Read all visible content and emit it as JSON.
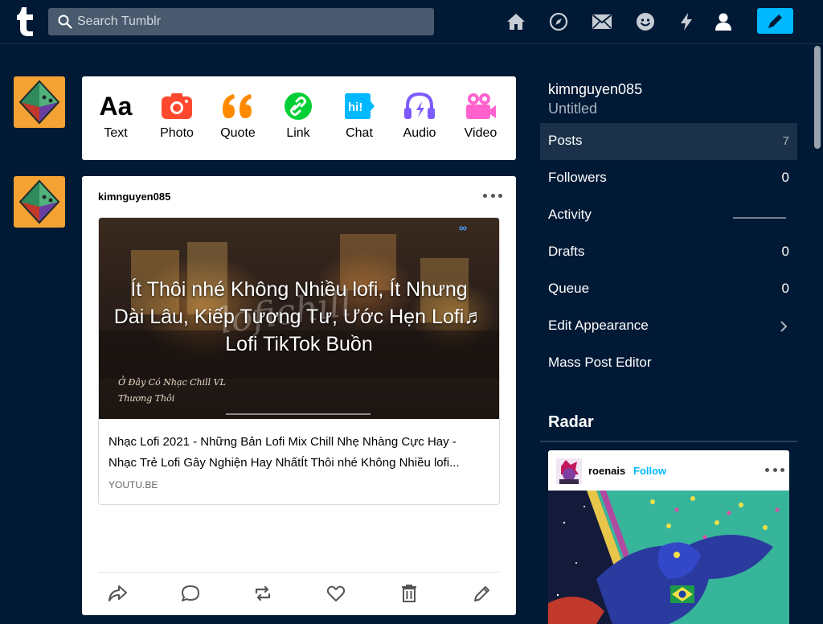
{
  "header": {
    "search_placeholder": "Search Tumblr",
    "nav_icons": [
      "home-icon",
      "explore-icon",
      "inbox-icon",
      "messaging-icon",
      "activity-icon",
      "account-icon",
      "compose-icon"
    ],
    "brand_color": "#001935",
    "accent_color": "#00b8ff"
  },
  "composer": {
    "types": [
      {
        "label": "Text",
        "icon": "text-icon",
        "color": "#000000"
      },
      {
        "label": "Photo",
        "icon": "photo-icon",
        "color": "#ff492f"
      },
      {
        "label": "Quote",
        "icon": "quote-icon",
        "color": "#ff8a00"
      },
      {
        "label": "Link",
        "icon": "link-icon",
        "color": "#00cf35"
      },
      {
        "label": "Chat",
        "icon": "chat-icon",
        "color": "#00b8ff"
      },
      {
        "label": "Audio",
        "icon": "audio-icon",
        "color": "#7c5cff"
      },
      {
        "label": "Video",
        "icon": "video-icon",
        "color": "#ff62ce"
      }
    ]
  },
  "post": {
    "username": "kimnguyen085",
    "thumbnail": {
      "title": "Ít Thôi nhé Không Nhiều lofi, Ít Nhưng Dài Lâu, Kiếp Tương Tư, Ước Hẹn Lofi♬ Lofi TikTok Buồn",
      "caption_1": "Ở Đây Có Nhạc Chill VL",
      "caption_2": "Thương Thôi"
    },
    "link_title_line1": "Nhạc Lofi 2021 - Những Bản Lofi Mix Chill Nhẹ Nhàng Cực Hay -",
    "link_title_line2": "Nhạc Trẻ Lofi Gây Nghiện Hay NhấtÍt Thôi nhé Không Nhiều lofi...",
    "link_domain": "YOUTU.BE",
    "footer_icons": [
      "share-icon",
      "reply-icon",
      "reblog-icon",
      "like-icon",
      "delete-icon",
      "edit-icon"
    ]
  },
  "sidebar": {
    "blog_name": "kimnguyen085",
    "blog_title": "Untitled",
    "items": [
      {
        "label": "Posts",
        "value": "7"
      },
      {
        "label": "Followers",
        "value": "0"
      },
      {
        "label": "Activity",
        "value": ""
      },
      {
        "label": "Drafts",
        "value": "0"
      },
      {
        "label": "Queue",
        "value": "0"
      },
      {
        "label": "Edit Appearance",
        "value": ""
      },
      {
        "label": "Mass Post Editor",
        "value": ""
      }
    ]
  },
  "radar": {
    "title": "Radar",
    "username": "roenais",
    "follow_label": "Follow"
  }
}
